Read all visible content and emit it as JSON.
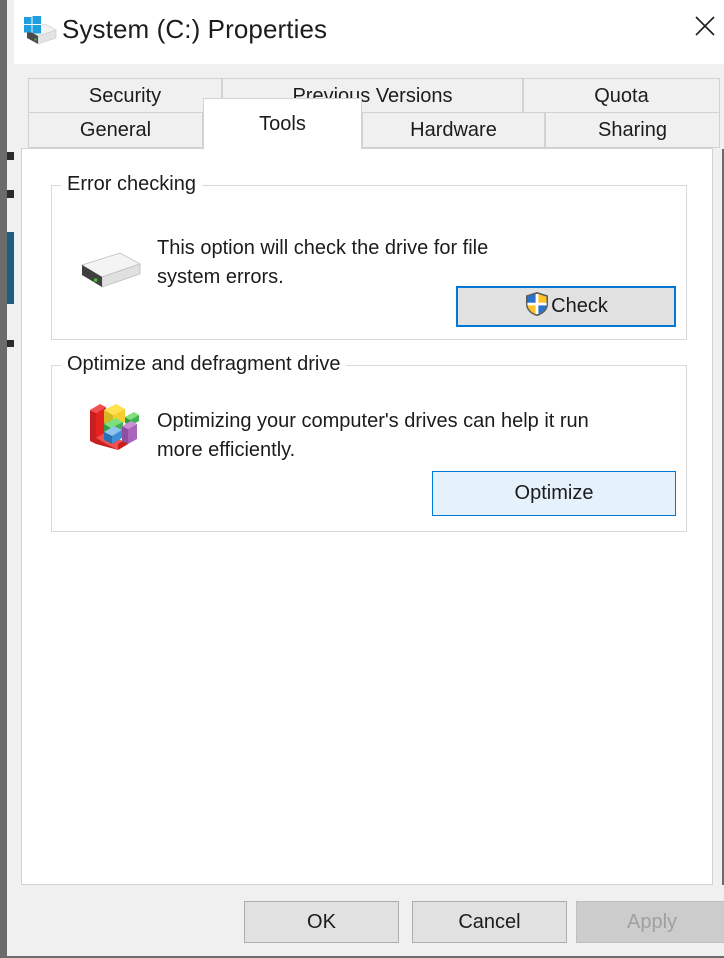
{
  "window": {
    "title": "System (C:) Properties",
    "title_icon": "system-drive-icon",
    "close_icon": "close-icon"
  },
  "tabs": {
    "top_row": [
      {
        "label": "Security",
        "selected": false
      },
      {
        "label": "Previous Versions",
        "selected": false
      },
      {
        "label": "Quota",
        "selected": false
      }
    ],
    "bottom_row": [
      {
        "label": "General",
        "selected": false
      },
      {
        "label": "Tools",
        "selected": true
      },
      {
        "label": "Hardware",
        "selected": false
      },
      {
        "label": "Sharing",
        "selected": false
      }
    ]
  },
  "tab_content": {
    "groups": [
      {
        "legend": "Error checking",
        "icon": "hard-drive-icon",
        "description_line1": "This option will check the drive for file",
        "description_line2": "system errors.",
        "button_label": "Check",
        "button_icon": "uac-shield-icon"
      },
      {
        "legend": "Optimize and defragment drive",
        "icon": "defragment-icon",
        "description_line1": "Optimizing your computer's drives can help it run",
        "description_line2": "more efficiently.",
        "button_label": "Optimize"
      }
    ]
  },
  "footer": {
    "ok_label": "OK",
    "cancel_label": "Cancel",
    "apply_label": "Apply",
    "apply_disabled": true
  },
  "colors": {
    "accent": "#0078d7",
    "button_hover_fill": "#e5f1fb",
    "window_chrome": "#f0f0f0",
    "panel": "#ffffff",
    "text": "#1c1c1c",
    "disabled_text": "#a0a0a0"
  }
}
